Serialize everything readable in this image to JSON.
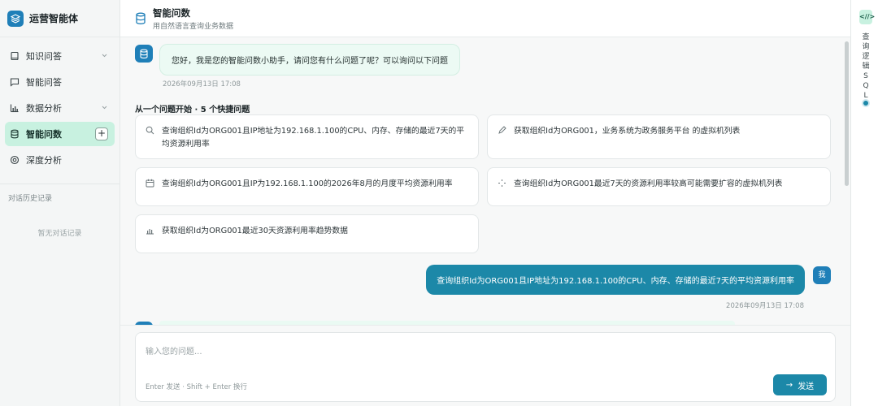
{
  "app": {
    "title": "运营智能体"
  },
  "sidebar": {
    "items": [
      {
        "label": "知识问答",
        "icon": "book-icon",
        "has_chevron": true
      },
      {
        "label": "智能问答",
        "icon": "chat-icon",
        "has_chevron": false
      },
      {
        "label": "数据分析",
        "icon": "bar-chart-icon",
        "has_chevron": true
      },
      {
        "label": "智能问数",
        "icon": "database-icon",
        "active": true,
        "action": "+"
      },
      {
        "label": "深度分析",
        "icon": "target-icon",
        "has_chevron": false
      }
    ],
    "history_label": "对话历史记录",
    "history_empty": "暂无对话记录"
  },
  "header": {
    "title": "智能问数",
    "subtitle": "用自然语言查询业务数据"
  },
  "chat": {
    "greeting": "您好，我是您的智能问数小助手，请问您有什么问题了呢？可以询问以下问题",
    "greeting_time": "2026年09月13日 17:08",
    "quick_title": "从一个问题开始 · 5 个快捷问题",
    "quick_questions": [
      {
        "text": "查询组织Id为ORG001且IP地址为192.168.1.100的CPU、内存、存储的最近7天的平均资源利用率",
        "icon": "search-icon"
      },
      {
        "text": "获取组织Id为ORG001，业务系统为政务服务平台 的虚拟机列表",
        "icon": "pen-icon"
      },
      {
        "text": "查询组织Id为ORG001且IP为192.168.1.100的2026年8月的月度平均资源利用率",
        "icon": "calendar-icon"
      },
      {
        "text": "查询组织Id为ORG001最近7天的资源利用率较高可能需要扩容的虚拟机列表",
        "icon": "loading-icon"
      },
      {
        "text": "获取组织Id为ORG001最近30天资源利用率趋势数据",
        "icon": "bars-icon"
      }
    ],
    "user_message": "查询组织Id为ORG001且IP地址为192.168.1.100的CPU、内存、存储的最近7天的平均资源利用率",
    "user_avatar": "我",
    "user_time": "2026年09月13日 17:08"
  },
  "composer": {
    "placeholder": "输入您的问题...",
    "hint": "Enter 发送 · Shift + Enter 换行",
    "send_label": "发送",
    "send_arrow": "→"
  },
  "rail": {
    "button": "<//>",
    "label": "查询逻辑SQL"
  },
  "colors": {
    "accent": "#1c88a8",
    "active_bg": "#c8f1e0",
    "bot_bubble": "#ecfaf4"
  }
}
